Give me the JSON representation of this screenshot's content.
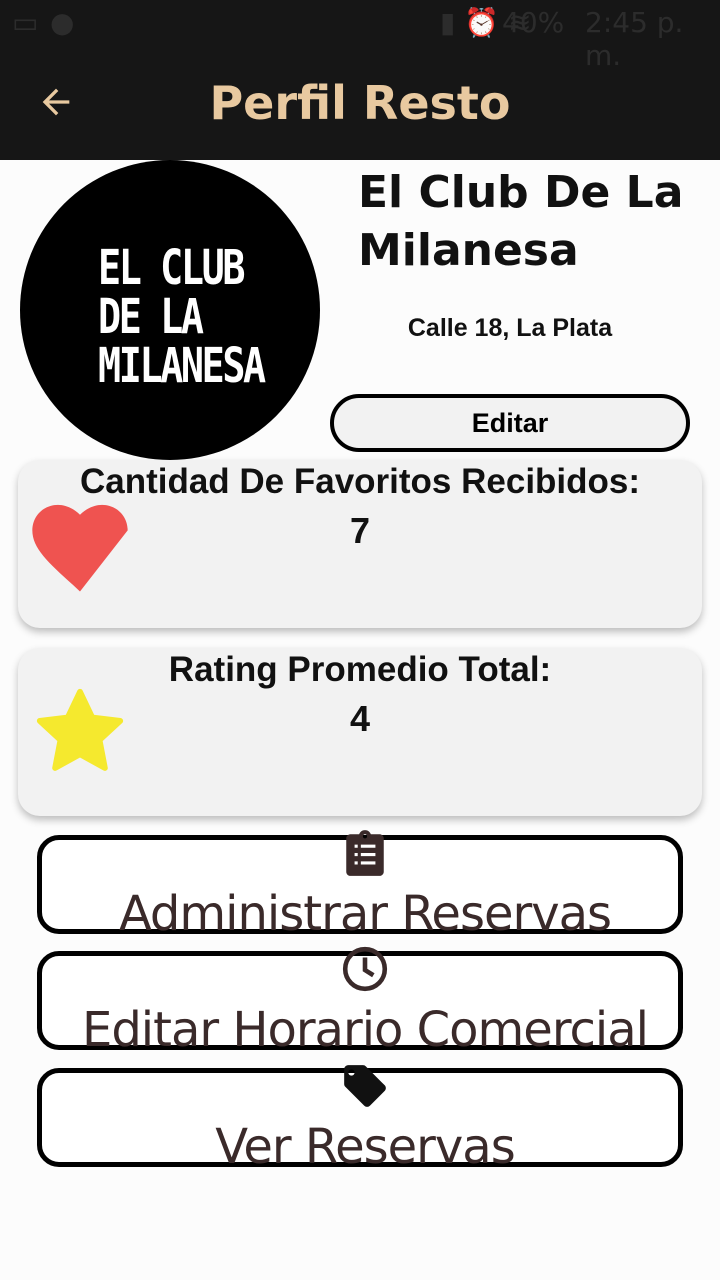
{
  "status_bar": {
    "battery": "40%",
    "time": "2:45 p. m."
  },
  "header": {
    "title": "Perfil Resto"
  },
  "profile": {
    "logo_lines": [
      "EL CLUB",
      "DE LA",
      "MILANESA"
    ],
    "name": "El Club De La Milanesa",
    "address": "Calle 18, La Plata",
    "edit_label": "Editar"
  },
  "favorites": {
    "label": "Cantidad De Favoritos Recibidos:",
    "value": "7",
    "icon": "heart-icon",
    "color": "#ef5350"
  },
  "rating": {
    "label": "Rating Promedio Total:",
    "value": "4",
    "icon": "star-icon",
    "color": "#f5e92e"
  },
  "actions": [
    {
      "label": "Administrar Reservas",
      "icon": "clipboard-list-icon"
    },
    {
      "label": "Editar Horario Comercial",
      "icon": "clock-icon"
    },
    {
      "label": "Ver Reservas",
      "icon": "tag-icon"
    }
  ]
}
